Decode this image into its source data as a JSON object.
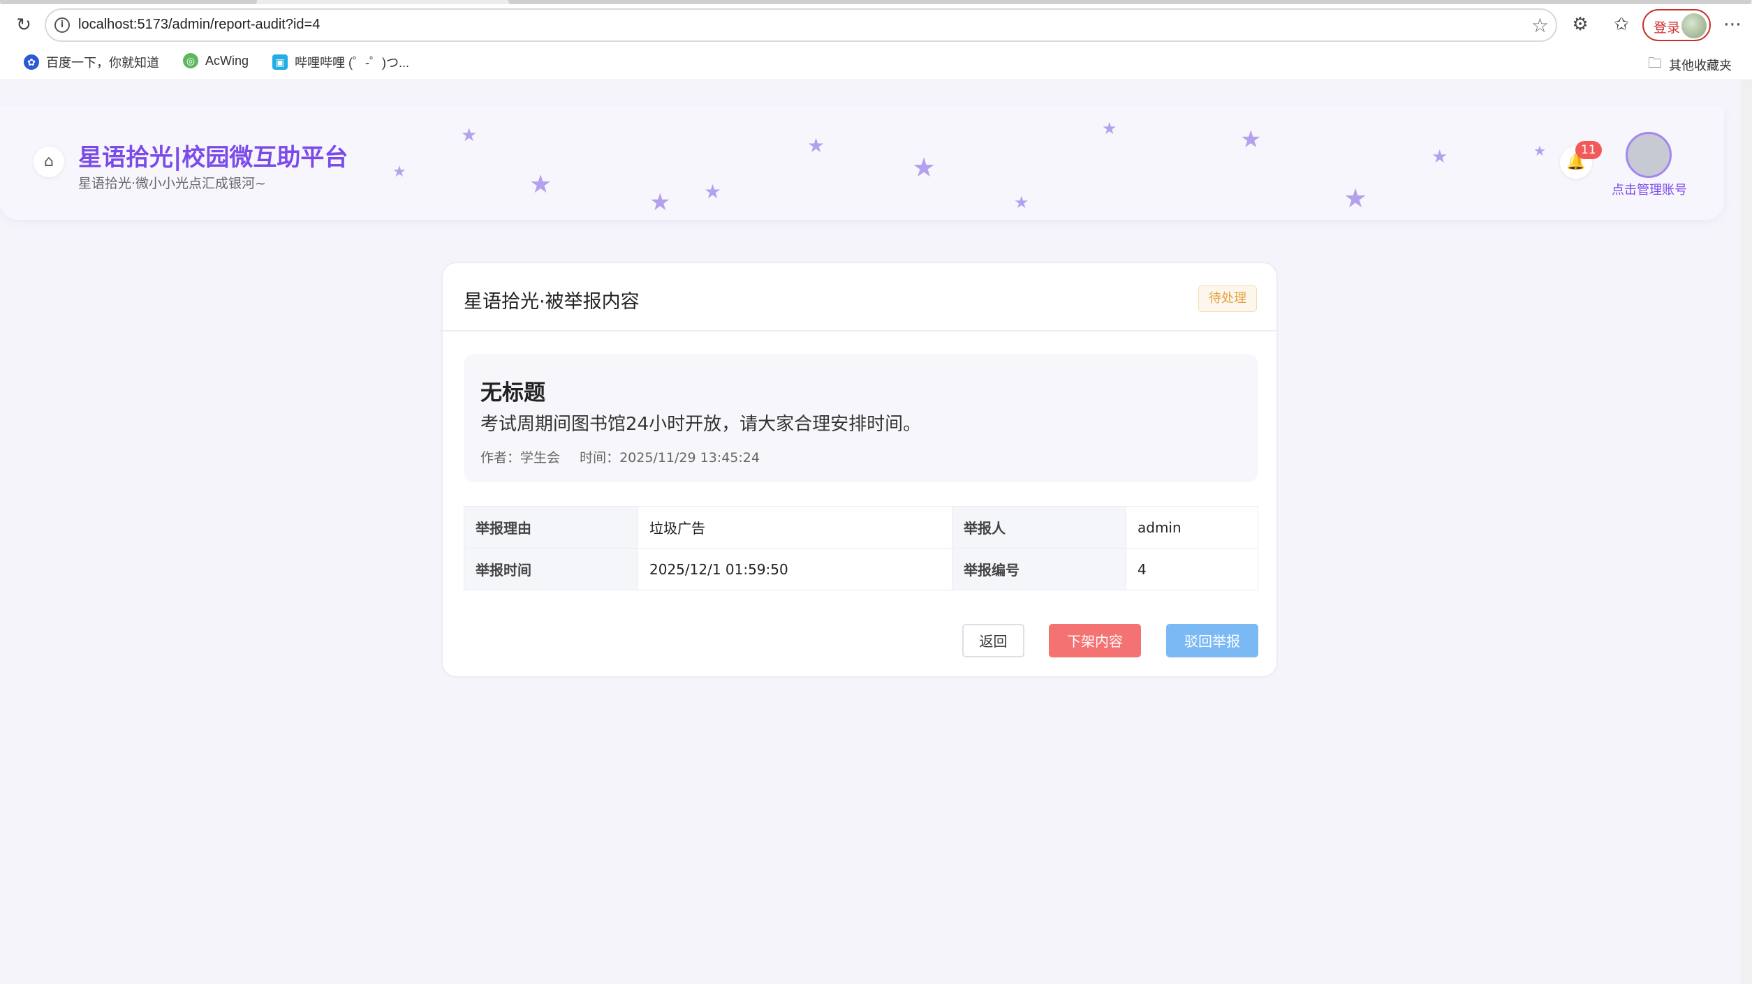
{
  "browser": {
    "url": "localhost:5173/admin/report-audit?id=4",
    "login_label": "登录",
    "bookmarks": [
      {
        "label": "百度一下，你就知道"
      },
      {
        "label": "AcWing"
      },
      {
        "label": "哔哩哔哩 (゜-゜)つ..."
      }
    ],
    "other_bookmarks_label": "其他收藏夹"
  },
  "header": {
    "title": "星语拾光|校园微互助平台",
    "subtitle": "星语拾光·微小小光点汇成银河~",
    "notification_count": "11",
    "account_label": "点击管理账号"
  },
  "card": {
    "title": "星语拾光·被举报内容",
    "status": "待处理",
    "post": {
      "title": "无标题",
      "body": "考试周期间图书馆24小时开放，请大家合理安排时间。",
      "author": "作者：学生会",
      "time": "时间：2025/11/29 13:45:24"
    },
    "details": [
      {
        "k1": "举报理由",
        "v1": "垃圾广告",
        "k2": "举报人",
        "v2": "admin"
      },
      {
        "k1": "举报时间",
        "v1": "2025/12/1 01:59:50",
        "k2": "举报编号",
        "v2": "4"
      }
    ],
    "actions": {
      "back": "返回",
      "takedown": "下架内容",
      "reject": "驳回举报"
    }
  },
  "colors": {
    "accent": "#7a4be8",
    "star": "#b3a1ee",
    "danger": "#f47272",
    "primary_light": "#7bb9f5",
    "warning": "#e6a23c"
  }
}
